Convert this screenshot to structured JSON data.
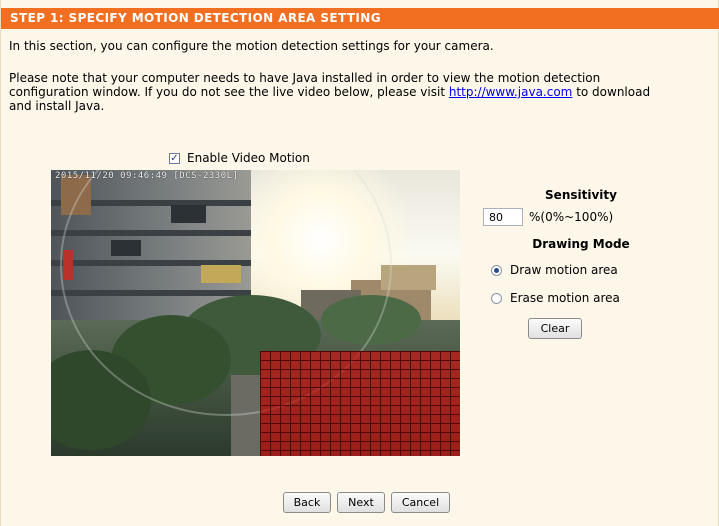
{
  "header": {
    "title": "STEP 1: SPECIFY MOTION DETECTION AREA SETTING"
  },
  "intro": {
    "text": "In this section, you can configure the motion detection settings for your camera."
  },
  "note": {
    "line1": "Please note that your computer needs to have Java installed in order to view the motion detection",
    "line2_before": "configuration window. If you do not see the live video below, please visit ",
    "link": "http://www.java.com",
    "line2_after": " to download",
    "line3": "and install Java."
  },
  "enable": {
    "label": "Enable Video Motion",
    "checked": true,
    "check_glyph": "✓"
  },
  "video": {
    "osd_text": "2015/11/20 09:46:49 [DCS-2330L]"
  },
  "sensitivity": {
    "title": "Sensitivity",
    "value": "80",
    "range_label": "%(0%~100%)"
  },
  "drawing_mode": {
    "title": "Drawing Mode",
    "options": [
      {
        "label": "Draw motion area",
        "selected": true
      },
      {
        "label": "Erase motion area",
        "selected": false
      }
    ],
    "clear_label": "Clear"
  },
  "footer": {
    "back_label": "Back",
    "next_label": "Next",
    "cancel_label": "Cancel"
  },
  "colors": {
    "header": "#f26f21",
    "panel": "#fdf7e9",
    "motion_area": "#c81414",
    "link": "#0000ee"
  }
}
